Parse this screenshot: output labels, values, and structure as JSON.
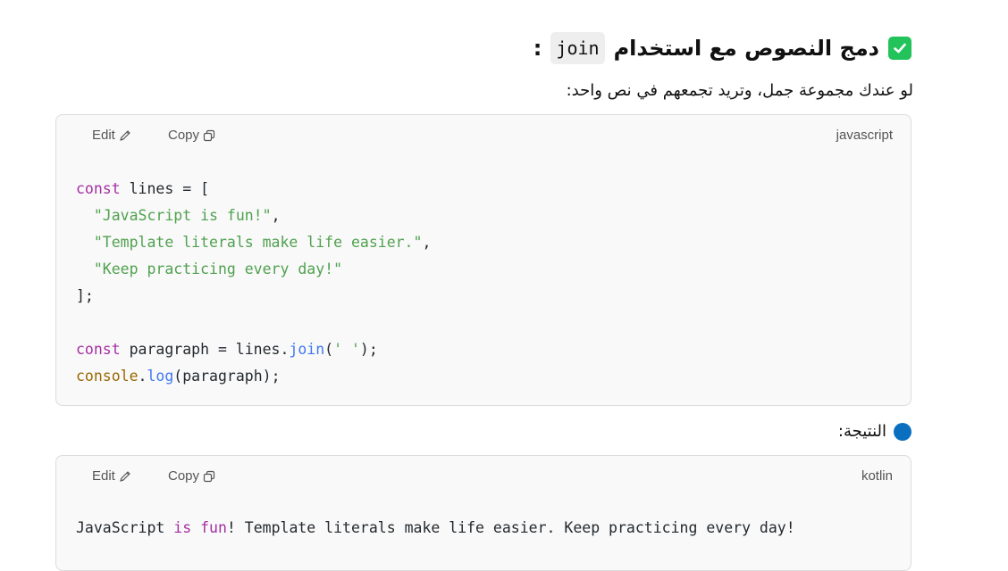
{
  "heading": {
    "title_before": "دمج النصوص مع استخدام",
    "inline_code": "join",
    "title_after": ":"
  },
  "intro_text": "لو عندك مجموعة جمل، وتريد تجمعهم في نص واحد:",
  "code_block_1": {
    "language": "javascript",
    "edit_label": "Edit",
    "copy_label": "Copy",
    "lines": {
      "l1_kw": "const",
      "l1_rest": " lines = [",
      "l2_str": "\"JavaScript is fun!\"",
      "l2_rest": ",",
      "l3_str": "\"Template literals make life easier.\"",
      "l3_rest": ",",
      "l4_str": "\"Keep practicing every day!\"",
      "l5": "];",
      "l7_kw": "const",
      "l7_a": " paragraph = lines.",
      "l7_fn": "join",
      "l7_b": "(",
      "l7_str": "' '",
      "l7_c": ");",
      "l8_obj": "console",
      "l8_a": ".",
      "l8_fn": "log",
      "l8_b": "(paragraph);"
    }
  },
  "result_label": "النتيجة:",
  "code_block_2": {
    "language": "kotlin",
    "edit_label": "Edit",
    "copy_label": "Copy",
    "output": {
      "a": "JavaScript ",
      "kw1": "is",
      "b": " ",
      "kw2": "fun",
      "c": "! Template literals make life easier. Keep practicing every day!"
    }
  },
  "icons": {
    "heading": "check-square-icon",
    "result": "blue-circle-icon",
    "edit": "pencil-icon",
    "copy": "copy-icon"
  },
  "colors": {
    "check_green": "#21c35a",
    "dot_blue": "#0b6fc0",
    "code_bg": "#f9f9f9",
    "keyword": "#a42ea2",
    "string": "#50a14f",
    "function": "#4078f2"
  }
}
